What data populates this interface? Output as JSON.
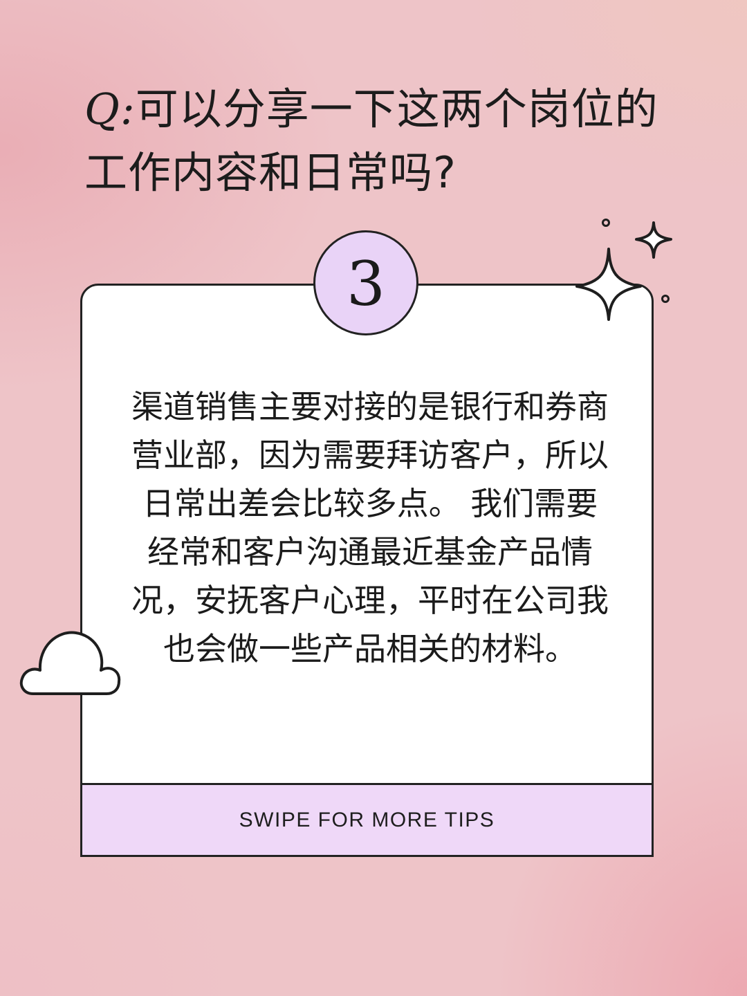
{
  "title": {
    "prefix": "Q:",
    "text": "可以分享一下这两个岗位的工作内容和日常吗?"
  },
  "badge": {
    "number": "3"
  },
  "card": {
    "body": "渠道销售主要对接的是银行和券商营业部，因为需要拜访客户，所以日常出差会比较多点。 我们需要经常和客户沟通最近基金产品情况，安抚客户心理，平时在公司我也会做一些产品相关的材料。",
    "footer": "SWIPE FOR MORE TIPS"
  },
  "decorations": {
    "sparkle": "sparkle-icon",
    "cloud": "cloud-icon"
  },
  "colors": {
    "badge_fill": "#e9d3f7",
    "footer_fill": "#efd8f8",
    "outline": "#222222"
  }
}
